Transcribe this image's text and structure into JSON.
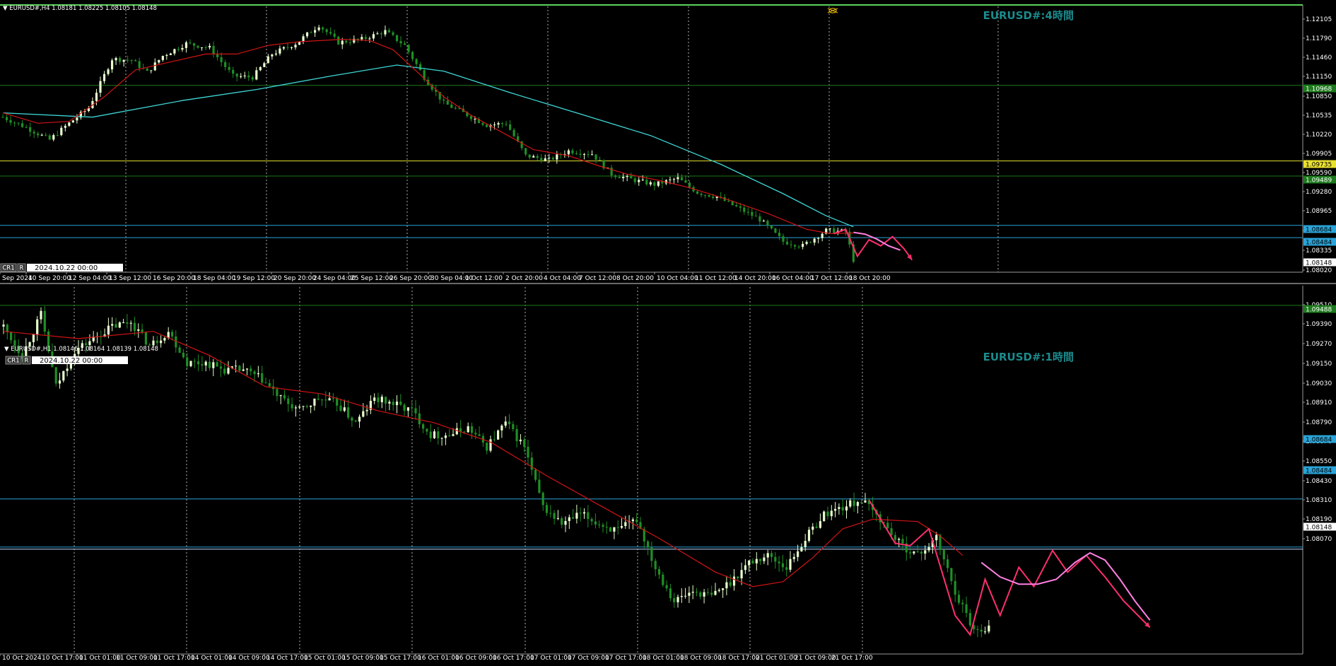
{
  "colors": {
    "background": "#000000",
    "grid_dotted": "#b0b0b0",
    "bull_candle": "#e8ffcf",
    "bear_candle": "#1f8f25",
    "ma_fast": "#d01414",
    "ma_slow": "#3fd7d7",
    "hline_green": "#1d7a1d",
    "hline_yellow": "#e8e030",
    "hline_blue": "#2aa4d8",
    "forecast_red": "#ff2f6e",
    "forecast_pink": "#ff7fe0",
    "panel_border": "#5bd35b",
    "watermark": "#1b8a8c"
  },
  "panels": [
    {
      "header": "▼ EURUSD#,H4  1.08181 1.08225 1.08105 1.08148",
      "watermark": "EURUSD#:4時間",
      "cr_button": "CR1",
      "r_button": "R",
      "date_field": "2024.10.22 00:00",
      "icon": "gold-bug-icon",
      "price_labels": [
        "1.12105",
        "1.11790",
        "1.11460",
        "1.11150",
        "1.10850",
        "1.10535",
        "1.10220",
        "1.09905",
        "1.09590",
        "1.09280",
        "1.08965",
        "1.08650",
        "1.08335",
        "1.08020"
      ],
      "time_labels": [
        "Sep 2024",
        "10 Sep 20:00",
        "12 Sep 04:00",
        "13 Sep 12:00",
        "16 Sep 20:00",
        "18 Sep 04:00",
        "19 Sep 12:00",
        "20 Sep 20:00",
        "24 Sep 04:00",
        "25 Sep 12:00",
        "26 Sep 20:00",
        "30 Sep 04:00",
        "1 Oct 12:00",
        "2 Oct 20:00",
        "4 Oct 04:00",
        "7 Oct 12:00",
        "8 Oct 20:00",
        "10 Oct 04:00",
        "11 Oct 12:00",
        "14 Oct 20:00",
        "16 Oct 04:00",
        "17 Oct 12:00",
        "18 Oct 20:00"
      ],
      "hline_tags": [
        {
          "text": "1.10968",
          "color": "#1d7a1d"
        },
        {
          "text": "1.09735",
          "color": "#e8e030"
        },
        {
          "text": "1.09489",
          "color": "#1d7a1d"
        },
        {
          "text": "1.08684",
          "color": "#2aa4d8"
        },
        {
          "text": "1.08484",
          "color": "#2aa4d8"
        },
        {
          "text": "1.08148",
          "color": "#ffffff"
        }
      ]
    },
    {
      "header": "▼ EURUSD#,H1  1.08146 1.08164 1.08139 1.08148",
      "watermark": "EURUSD#:1時間",
      "cr_button": "CR1",
      "r_button": "R",
      "date_field": "2024.10.22 00:00",
      "price_labels": [
        "1.09510",
        "1.09390",
        "1.09270",
        "1.09150",
        "1.09030",
        "1.08910",
        "1.08790",
        "1.08670",
        "1.08550",
        "1.08430",
        "1.08310",
        "1.08190",
        "1.08070"
      ],
      "time_labels": [
        "10 Oct 2024",
        "10 Oct 17:00",
        "11 Oct 01:00",
        "11 Oct 09:00",
        "11 Oct 17:00",
        "14 Oct 01:00",
        "14 Oct 09:00",
        "14 Oct 17:00",
        "15 Oct 01:00",
        "15 Oct 09:00",
        "15 Oct 17:00",
        "16 Oct 01:00",
        "16 Oct 09:00",
        "16 Oct 17:00",
        "17 Oct 01:00",
        "17 Oct 09:00",
        "17 Oct 17:00",
        "18 Oct 01:00",
        "18 Oct 09:00",
        "18 Oct 17:00",
        "21 Oct 01:00",
        "21 Oct 09:00",
        "21 Oct 17:00"
      ],
      "hline_tags": [
        {
          "text": "1.09488",
          "color": "#1d7a1d"
        },
        {
          "text": "1.08684",
          "color": "#2aa4d8"
        },
        {
          "text": "1.08484",
          "color": "#2aa4d8"
        },
        {
          "text": "1.08148",
          "color": "#ffffff"
        }
      ]
    }
  ],
  "chart_data": [
    {
      "type": "candlestick",
      "symbol": "EURUSD#",
      "timeframe": "H4",
      "ylim": [
        1.0792,
        1.1228
      ],
      "hlines": [
        1.10968,
        1.09735,
        1.09489,
        1.08684,
        1.08484
      ],
      "anchors": [
        [
          0,
          1.1045
        ],
        [
          6,
          1.1028
        ],
        [
          12,
          1.1008
        ],
        [
          16,
          1.103
        ],
        [
          22,
          1.106
        ],
        [
          28,
          1.114
        ],
        [
          33,
          1.1138
        ],
        [
          37,
          1.1118
        ],
        [
          41,
          1.1145
        ],
        [
          47,
          1.1165
        ],
        [
          53,
          1.1158
        ],
        [
          59,
          1.1112
        ],
        [
          64,
          1.111
        ],
        [
          69,
          1.1148
        ],
        [
          75,
          1.1165
        ],
        [
          81,
          1.1195
        ],
        [
          86,
          1.1167
        ],
        [
          92,
          1.1172
        ],
        [
          98,
          1.1185
        ],
        [
          103,
          1.1162
        ],
        [
          108,
          1.111
        ],
        [
          113,
          1.1068
        ],
        [
          118,
          1.1052
        ],
        [
          124,
          1.1032
        ],
        [
          129,
          1.1035
        ],
        [
          134,
          1.0982
        ],
        [
          140,
          1.0975
        ],
        [
          145,
          1.099
        ],
        [
          151,
          1.0985
        ],
        [
          156,
          1.0952
        ],
        [
          162,
          1.0942
        ],
        [
          167,
          1.0935
        ],
        [
          173,
          1.0945
        ],
        [
          178,
          1.0922
        ],
        [
          183,
          1.0915
        ],
        [
          189,
          1.0895
        ],
        [
          194,
          1.0878
        ],
        [
          200,
          1.0842
        ],
        [
          205,
          1.0835
        ],
        [
          211,
          1.086
        ],
        [
          216,
          1.0858
        ],
        [
          218,
          1.0812
        ]
      ],
      "ma_fast": [
        [
          0,
          1.1052
        ],
        [
          9,
          1.1035
        ],
        [
          17,
          1.1038
        ],
        [
          26,
          1.1078
        ],
        [
          34,
          1.1122
        ],
        [
          43,
          1.1135
        ],
        [
          52,
          1.1148
        ],
        [
          60,
          1.1148
        ],
        [
          68,
          1.1162
        ],
        [
          76,
          1.1168
        ],
        [
          87,
          1.1172
        ],
        [
          94,
          1.117
        ],
        [
          100,
          1.1155
        ],
        [
          106,
          1.112
        ],
        [
          113,
          1.1078
        ],
        [
          120,
          1.1048
        ],
        [
          128,
          1.102
        ],
        [
          136,
          1.0992
        ],
        [
          145,
          1.0982
        ],
        [
          153,
          1.0965
        ],
        [
          160,
          1.0952
        ],
        [
          168,
          1.0942
        ],
        [
          176,
          1.093
        ],
        [
          186,
          1.091
        ],
        [
          196,
          1.0888
        ],
        [
          206,
          1.0862
        ],
        [
          212,
          1.0855
        ],
        [
          218,
          1.0856
        ]
      ],
      "ma_slow": [
        [
          0,
          1.1052
        ],
        [
          23,
          1.1045
        ],
        [
          46,
          1.1072
        ],
        [
          65,
          1.109
        ],
        [
          84,
          1.1112
        ],
        [
          101,
          1.113
        ],
        [
          113,
          1.112
        ],
        [
          130,
          1.1085
        ],
        [
          148,
          1.105
        ],
        [
          166,
          1.1015
        ],
        [
          184,
          1.0968
        ],
        [
          200,
          1.092
        ],
        [
          211,
          1.0884
        ],
        [
          218,
          1.0866
        ]
      ],
      "forecast_red": [
        [
          213,
          1.0855
        ],
        [
          216,
          1.0862
        ],
        [
          219,
          1.0818
        ],
        [
          222,
          1.0845
        ],
        [
          225,
          1.0835
        ],
        [
          228,
          1.085
        ],
        [
          231,
          1.083
        ],
        [
          233,
          1.0812
        ]
      ],
      "forecast_pink": [
        [
          218,
          1.0857
        ],
        [
          221,
          1.0854
        ],
        [
          224,
          1.0846
        ],
        [
          227,
          1.0835
        ],
        [
          230,
          1.0828
        ]
      ]
    },
    {
      "type": "candlestick",
      "symbol": "EURUSD#",
      "timeframe": "H1",
      "ylim": [
        1.0804,
        1.0957
      ],
      "hlines": [
        1.09488,
        1.08684,
        1.08484
      ],
      "anchors": [
        [
          0,
          1.094
        ],
        [
          5,
          1.0928
        ],
        [
          10,
          1.0945
        ],
        [
          14,
          1.0915
        ],
        [
          19,
          1.093
        ],
        [
          24,
          1.0935
        ],
        [
          29,
          1.094
        ],
        [
          34,
          1.0942
        ],
        [
          39,
          1.0932
        ],
        [
          44,
          1.0938
        ],
        [
          49,
          1.0925
        ],
        [
          54,
          1.0925
        ],
        [
          59,
          1.0922
        ],
        [
          64,
          1.0922
        ],
        [
          69,
          1.0918
        ],
        [
          74,
          1.091
        ],
        [
          79,
          1.0905
        ],
        [
          84,
          1.091
        ],
        [
          89,
          1.0908
        ],
        [
          94,
          1.09
        ],
        [
          99,
          1.091
        ],
        [
          104,
          1.0908
        ],
        [
          109,
          1.0905
        ],
        [
          114,
          1.0895
        ],
        [
          119,
          1.0895
        ],
        [
          124,
          1.0898
        ],
        [
          129,
          1.089
        ],
        [
          134,
          1.09
        ],
        [
          139,
          1.089
        ],
        [
          144,
          1.0865
        ],
        [
          149,
          1.0858
        ],
        [
          154,
          1.0862
        ],
        [
          159,
          1.0858
        ],
        [
          164,
          1.0855
        ],
        [
          169,
          1.086
        ],
        [
          174,
          1.084
        ],
        [
          179,
          1.0826
        ],
        [
          184,
          1.083
        ],
        [
          189,
          1.0828
        ],
        [
          194,
          1.0834
        ],
        [
          199,
          1.0842
        ],
        [
          204,
          1.0845
        ],
        [
          209,
          1.084
        ],
        [
          214,
          1.0852
        ],
        [
          219,
          1.0862
        ],
        [
          224,
          1.0865
        ],
        [
          229,
          1.0868
        ],
        [
          234,
          1.086
        ],
        [
          239,
          1.085
        ],
        [
          244,
          1.0845
        ],
        [
          249,
          1.0852
        ],
        [
          254,
          1.083
        ],
        [
          259,
          1.0814
        ],
        [
          263,
          1.0815
        ]
      ],
      "ma_fast": [
        [
          0,
          1.0938
        ],
        [
          20,
          1.0935
        ],
        [
          40,
          1.0938
        ],
        [
          55,
          1.0928
        ],
        [
          70,
          1.0915
        ],
        [
          85,
          1.0912
        ],
        [
          100,
          1.0905
        ],
        [
          115,
          1.09
        ],
        [
          130,
          1.0892
        ],
        [
          145,
          1.0878
        ],
        [
          160,
          1.0865
        ],
        [
          175,
          1.0852
        ],
        [
          190,
          1.0838
        ],
        [
          200,
          1.0832
        ],
        [
          208,
          1.0834
        ],
        [
          216,
          1.0844
        ],
        [
          224,
          1.0856
        ],
        [
          232,
          1.086
        ],
        [
          244,
          1.0859
        ],
        [
          250,
          1.0853
        ],
        [
          256,
          1.0845
        ]
      ],
      "forecast_red": [
        [
          231,
          1.0868
        ],
        [
          238,
          1.085
        ],
        [
          242,
          1.0849
        ],
        [
          247,
          1.0856
        ],
        [
          254,
          1.082
        ],
        [
          258,
          1.0812
        ],
        [
          262,
          1.0835
        ],
        [
          266,
          1.082
        ],
        [
          271,
          1.084
        ],
        [
          275,
          1.0832
        ],
        [
          280,
          1.0847
        ],
        [
          284,
          1.0838
        ],
        [
          289,
          1.0845
        ],
        [
          294,
          1.0836
        ],
        [
          299,
          1.0826
        ],
        [
          306,
          1.0815
        ]
      ],
      "forecast_pink": [
        [
          261,
          1.0842
        ],
        [
          266,
          1.0836
        ],
        [
          271,
          1.0833
        ],
        [
          276,
          1.0833
        ],
        [
          281,
          1.0835
        ],
        [
          286,
          1.0842
        ],
        [
          290,
          1.0846
        ],
        [
          294,
          1.0843
        ],
        [
          298,
          1.0835
        ],
        [
          302,
          1.0826
        ],
        [
          306,
          1.0818
        ]
      ]
    }
  ]
}
